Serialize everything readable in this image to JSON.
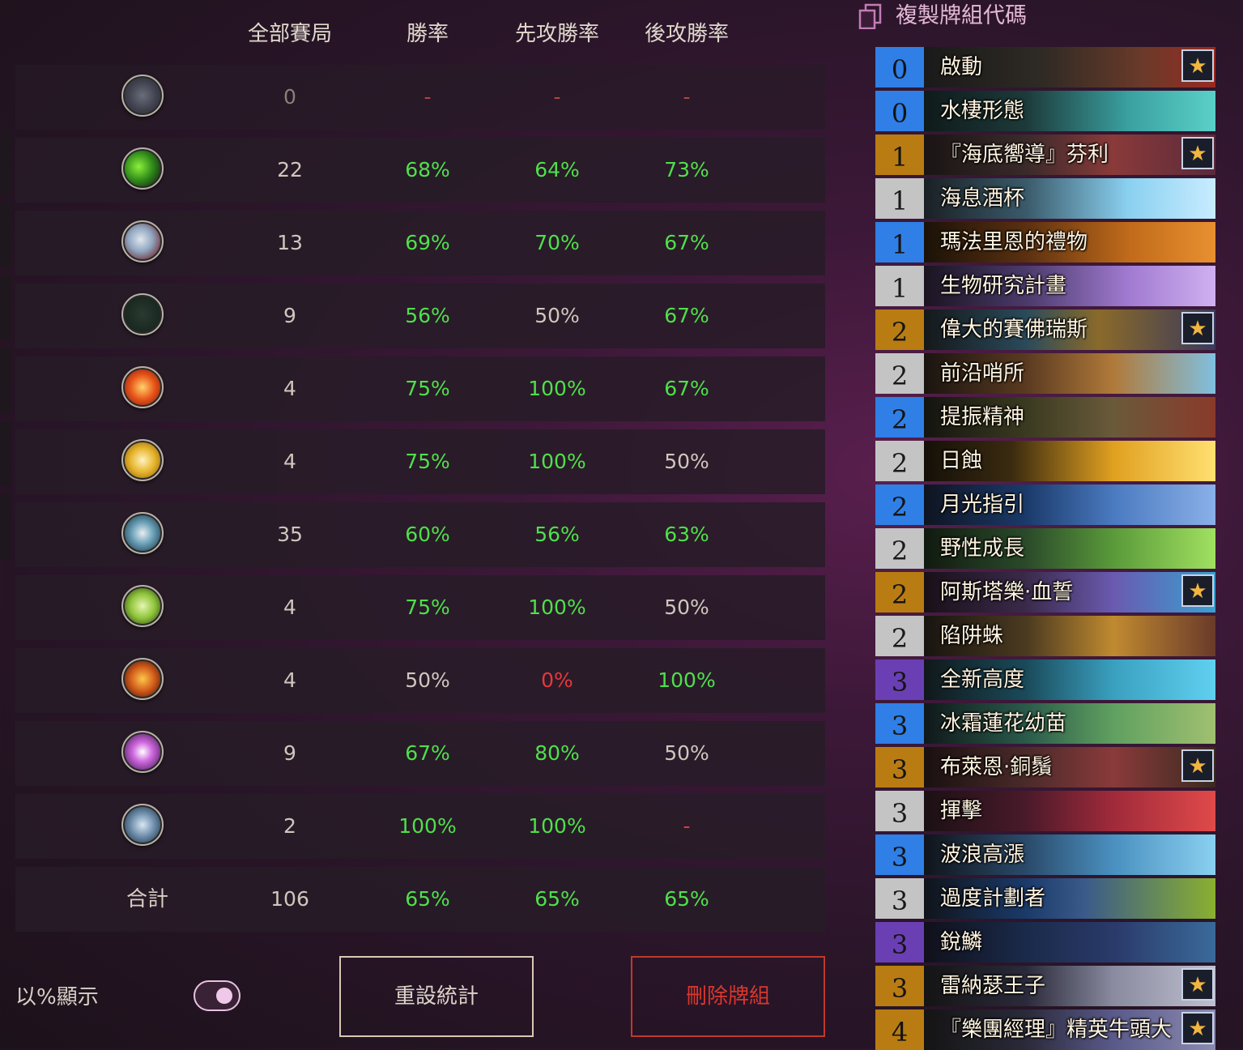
{
  "table": {
    "headers": {
      "games": "全部賽局",
      "winrate": "勝率",
      "first": "先攻勝率",
      "second": "後攻勝率"
    },
    "rows": [
      {
        "icon": "neutral-class-icon",
        "games": "0",
        "winrate": "-",
        "first": "-",
        "second": "-"
      },
      {
        "icon": "demon-hunter-class-icon",
        "games": "22",
        "winrate": "68%",
        "first": "64%",
        "second": "73%"
      },
      {
        "icon": "druid-class-icon",
        "games": "13",
        "winrate": "69%",
        "first": "70%",
        "second": "67%"
      },
      {
        "icon": "hunter-class-icon",
        "games": "9",
        "winrate": "56%",
        "first": "50%",
        "second": "67%"
      },
      {
        "icon": "mage-class-icon",
        "games": "4",
        "winrate": "75%",
        "first": "100%",
        "second": "67%"
      },
      {
        "icon": "paladin-class-icon",
        "games": "4",
        "winrate": "75%",
        "first": "100%",
        "second": "50%"
      },
      {
        "icon": "priest-class-icon",
        "games": "35",
        "winrate": "60%",
        "first": "56%",
        "second": "63%"
      },
      {
        "icon": "rogue-class-icon",
        "games": "4",
        "winrate": "75%",
        "first": "100%",
        "second": "50%"
      },
      {
        "icon": "shaman-class-icon",
        "games": "4",
        "winrate": "50%",
        "first": "0%",
        "second": "100%"
      },
      {
        "icon": "warlock-class-icon",
        "games": "9",
        "winrate": "67%",
        "first": "80%",
        "second": "50%"
      },
      {
        "icon": "warrior-class-icon",
        "games": "2",
        "winrate": "100%",
        "first": "100%",
        "second": "-"
      }
    ],
    "total": {
      "label": "合計",
      "games": "106",
      "winrate": "65%",
      "first": "65%",
      "second": "65%"
    }
  },
  "controls": {
    "percent_toggle_label": "以%顯示",
    "percent_toggle_on": true,
    "reset_button": "重設統計",
    "delete_button": "刪除牌組"
  },
  "deck": {
    "copy_label": "複製牌組代碼",
    "cards": [
      {
        "cost": "0",
        "name": "啟動",
        "legendary": true
      },
      {
        "cost": "0",
        "name": "水棲形態",
        "legendary": false
      },
      {
        "cost": "1",
        "name": "『海底嚮導』芬利",
        "legendary": true
      },
      {
        "cost": "1",
        "name": "海息酒杯",
        "legendary": false
      },
      {
        "cost": "1",
        "name": "瑪法里恩的禮物",
        "legendary": false
      },
      {
        "cost": "1",
        "name": "生物研究計畫",
        "legendary": false
      },
      {
        "cost": "2",
        "name": "偉大的賽佛瑞斯",
        "legendary": true
      },
      {
        "cost": "2",
        "name": "前沿哨所",
        "legendary": false
      },
      {
        "cost": "2",
        "name": "提振精神",
        "legendary": false
      },
      {
        "cost": "2",
        "name": "日蝕",
        "legendary": false
      },
      {
        "cost": "2",
        "name": "月光指引",
        "legendary": false
      },
      {
        "cost": "2",
        "name": "野性成長",
        "legendary": false
      },
      {
        "cost": "2",
        "name": "阿斯塔樂·血誓",
        "legendary": true
      },
      {
        "cost": "2",
        "name": "陷阱蛛",
        "legendary": false
      },
      {
        "cost": "3",
        "name": "全新高度",
        "legendary": false
      },
      {
        "cost": "3",
        "name": "冰霜蓮花幼苗",
        "legendary": false
      },
      {
        "cost": "3",
        "name": "布萊恩·銅鬚",
        "legendary": true
      },
      {
        "cost": "3",
        "name": "揮擊",
        "legendary": false
      },
      {
        "cost": "3",
        "name": "波浪高漲",
        "legendary": false
      },
      {
        "cost": "3",
        "name": "過度計劃者",
        "legendary": false
      },
      {
        "cost": "3",
        "name": "銳鱗",
        "legendary": false
      },
      {
        "cost": "3",
        "name": "雷納瑟王子",
        "legendary": true
      },
      {
        "cost": "4",
        "name": "『樂團經理』精英牛頭大",
        "legendary": true
      }
    ],
    "star_glyph": "★"
  },
  "colors": {
    "positive": "#4fe04a",
    "negative": "#e5383b",
    "neutral": "#cfc7bc",
    "muted": "#8a8079",
    "cost_blue": "#2f7fe6",
    "cost_gold": "#b97c12",
    "cost_gray": "#c4c4c4",
    "cost_purple": "#6a3fb4"
  }
}
